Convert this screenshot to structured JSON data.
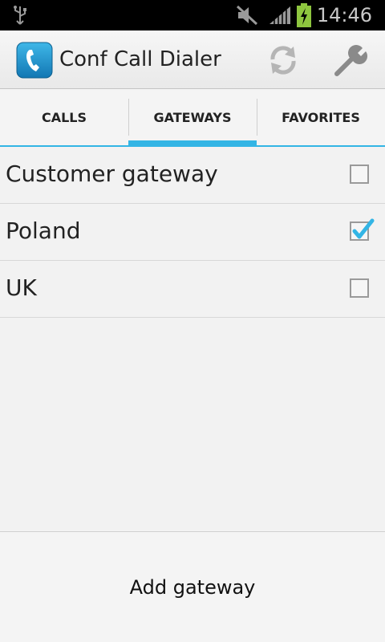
{
  "status_bar": {
    "time": "14:46",
    "icons": [
      "usb-icon",
      "mute-icon",
      "signal-icon",
      "battery-charging-icon"
    ]
  },
  "action_bar": {
    "title": "Conf Call Dialer",
    "app_icon": "phone-handset-icon",
    "actions": [
      "refresh-icon",
      "wrench-icon"
    ]
  },
  "tabs": [
    {
      "label": "CALLS",
      "active": false
    },
    {
      "label": "GATEWAYS",
      "active": true
    },
    {
      "label": "FAVORITES",
      "active": false
    }
  ],
  "gateways": [
    {
      "name": "Customer gateway",
      "checked": false
    },
    {
      "name": "Poland",
      "checked": true
    },
    {
      "name": "UK",
      "checked": false
    }
  ],
  "footer": {
    "add_label": "Add gateway"
  },
  "colors": {
    "accent": "#33b5e5",
    "status_bar_bg": "#000000",
    "background": "#f2f2f2"
  }
}
